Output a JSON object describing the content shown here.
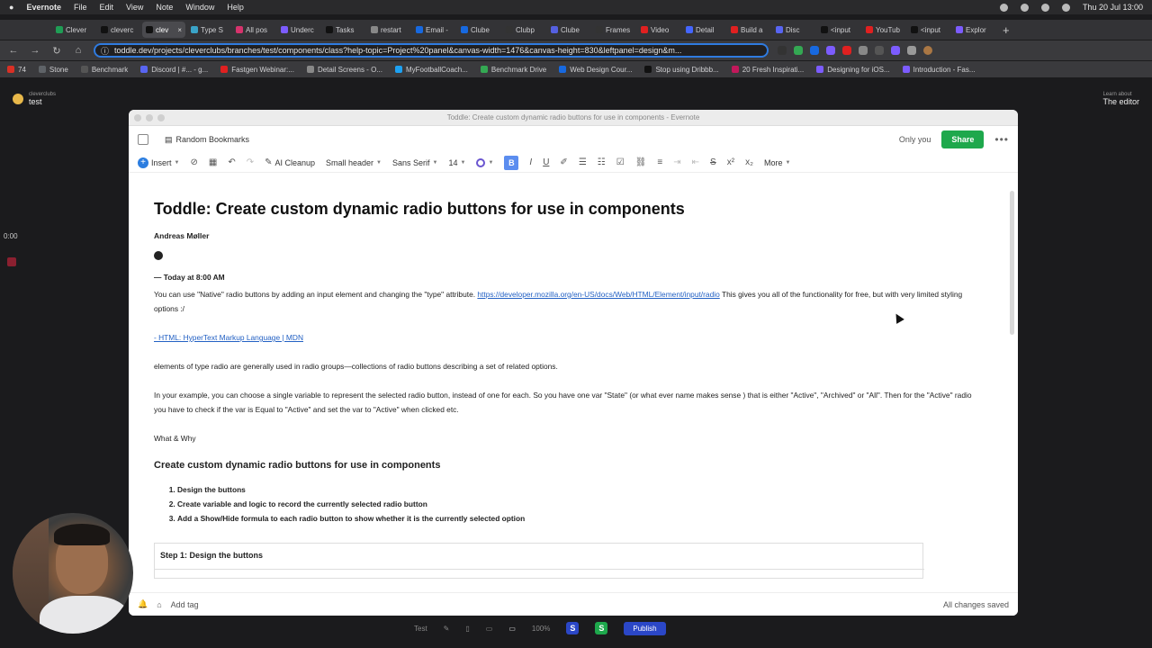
{
  "menubar": {
    "app": "Evernote",
    "menus": [
      "File",
      "Edit",
      "View",
      "Note",
      "Window",
      "Help"
    ],
    "datetime": "Thu 20 Jul  13:00"
  },
  "tabs": [
    {
      "label": "Clever",
      "color": "#1f9d55",
      "active": false
    },
    {
      "label": "cleverc",
      "color": "#111111",
      "active": false
    },
    {
      "label": "clev",
      "color": "#111111",
      "active": true
    },
    {
      "label": "Type S",
      "color": "#3aa3c7",
      "active": false
    },
    {
      "label": "All pos",
      "color": "#d6336c",
      "active": false
    },
    {
      "label": "Underc",
      "color": "#7c5cff",
      "active": false
    },
    {
      "label": "Tasks",
      "color": "#111111",
      "active": false
    },
    {
      "label": "restart",
      "color": "#888888",
      "active": false
    },
    {
      "label": "Email -",
      "color": "#1769e0",
      "active": false
    },
    {
      "label": "Clube",
      "color": "#1769e0",
      "active": false
    },
    {
      "label": "Clubp",
      "color": "#333333",
      "active": false
    },
    {
      "label": "Clube",
      "color": "#5560e0",
      "active": false
    },
    {
      "label": "Frames",
      "color": "#333333",
      "active": false
    },
    {
      "label": "Video",
      "color": "#e02020",
      "active": false
    },
    {
      "label": "Detail",
      "color": "#4466ff",
      "active": false
    },
    {
      "label": "Build a",
      "color": "#e02020",
      "active": false
    },
    {
      "label": "Disc",
      "color": "#5865f2",
      "active": false
    },
    {
      "label": "<input",
      "color": "#111111",
      "active": false
    },
    {
      "label": "YouTub",
      "color": "#e02020",
      "active": false
    },
    {
      "label": "<input",
      "color": "#111111",
      "active": false
    },
    {
      "label": "Explor",
      "color": "#7c5cff",
      "active": false
    }
  ],
  "address": {
    "url": "toddle.dev/projects/cleverclubs/branches/test/components/class?help-topic=Project%20panel&canvas-width=1476&canvas-height=830&leftpanel=design&m..."
  },
  "bookmarks": [
    {
      "label": "74",
      "color": "#d93025"
    },
    {
      "label": "Stone",
      "color": "#5f6368"
    },
    {
      "label": "Benchmark",
      "color": "#555555"
    },
    {
      "label": "Discord | #... - g...",
      "color": "#5865f2"
    },
    {
      "label": "Fastgen Webinar:...",
      "color": "#e02020"
    },
    {
      "label": "Detail Screens - O...",
      "color": "#888888"
    },
    {
      "label": "MyFootballCoach...",
      "color": "#1da1f2"
    },
    {
      "label": "Benchmark Drive",
      "color": "#34a853"
    },
    {
      "label": "Web Design Cour...",
      "color": "#1769e0"
    },
    {
      "label": "Stop using Dribbb...",
      "color": "#111111"
    },
    {
      "label": "20 Fresh Inspirati...",
      "color": "#c2185b"
    },
    {
      "label": "Designing for iOS...",
      "color": "#7c5cff"
    },
    {
      "label": "Introduction - Fas...",
      "color": "#7c5cff"
    }
  ],
  "toddle": {
    "org": "cleverclubs",
    "project": "test",
    "learn_small": "Learn about",
    "learn_title": "The editor",
    "timer": "0:00"
  },
  "evernote": {
    "window_title": "Toddle: Create custom dynamic radio buttons for use in components - Evernote",
    "notebook": "Random Bookmarks",
    "visibility": "Only you",
    "share": "Share",
    "toolbar": {
      "insert": "Insert",
      "ai_cleanup": "AI Cleanup",
      "heading": "Small header",
      "font": "Sans Serif",
      "size": "14",
      "more": "More"
    },
    "note": {
      "title": "Toddle: Create custom dynamic radio buttons for use in components",
      "author": "Andreas Møller",
      "date": "— Today at 8:00 AM",
      "p1_a": "You can use \"Native\" radio buttons by adding an input element and changing the \"type\" attribute.",
      "p1_link": "https://developer.mozilla.org/en-US/docs/Web/HTML/Element/input/radio",
      "p1_b": " This gives you all of the functionality for free, but with very limited styling options :/",
      "mdn_link": "- HTML: HyperText Markup Language | MDN",
      "p2": "elements of type radio are generally used in radio groups—collections of radio buttons describing a set of related options.",
      "p3": "In your example, you can choose a single variable to represent the selected radio button, instead of one for each.  So you have one var \"State\" (or what ever name makes sense ) that is either \"Active\", \"Archived\" or \"All\".  Then for the \"Active\" radio you have to check if the var  is Equal to \"Active\" and  set the var to \"Active\" when clicked etc.",
      "p4": "What & Why",
      "h2": "Create custom dynamic radio buttons for use in components",
      "steps": [
        "Design the buttons",
        "Create variable and logic to record the currently selected radio button",
        "Add a Show/Hide formula to each radio button to show whether it is the currently selected option"
      ],
      "step1_title": "Step 1: Design the buttons"
    },
    "footer": {
      "add_tag": "Add tag",
      "status": "All changes saved"
    }
  },
  "canvas_bar": {
    "name": "Test",
    "zoom": "100%",
    "publish": "Publish"
  }
}
